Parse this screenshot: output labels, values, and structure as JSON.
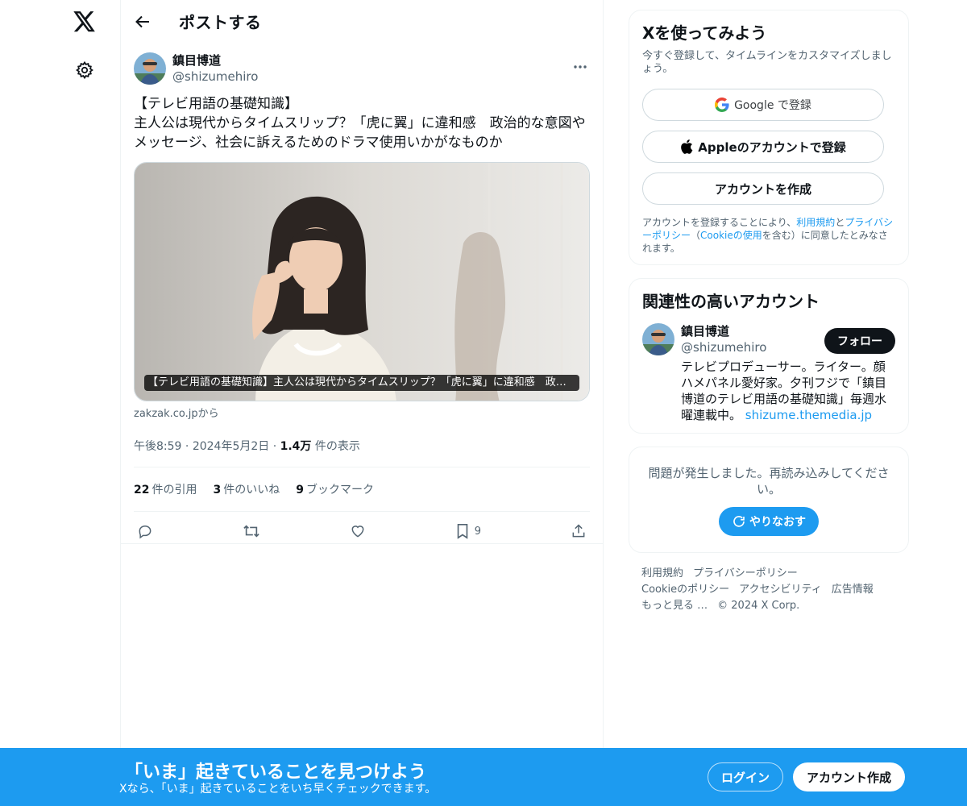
{
  "header": {
    "title": "ポストする"
  },
  "tweet": {
    "author_name": "鎮目博道",
    "author_handle": "@shizumehiro",
    "text": "【テレビ用語の基礎知識】\n主人公は現代からタイムスリップ？「虎に翼」に違和感　政治的な意図やメッセージ、社会に訴えるためのドラマ使用いかがなものか",
    "card_caption": "【テレビ用語の基礎知識】主人公は現代からタイムスリップ？「虎に翼」に違和感　政治的な意図やメッセージ、社会に訴えるためのドラマ使用いかがなものか",
    "card_source": "zakzak.co.jpから",
    "time": "午後8:59",
    "date": "2024年5月2日",
    "views_count": "1.4万",
    "views_label": " 件の表示",
    "quotes_count": "22",
    "quotes_label": "件の引用",
    "likes_count": "3",
    "likes_label": "件のいいね",
    "bookmarks_count": "9",
    "bookmarks_label": "ブックマーク",
    "bookmark_action_count": "9"
  },
  "signup": {
    "title": "Xを使ってみよう",
    "subtitle": "今すぐ登録して、タイムラインをカスタマイズしましょう。",
    "google_label": "Google で登録",
    "apple_label": "Appleのアカウントで登録",
    "create_label": "アカウントを作成",
    "legal_1": "アカウントを登録することにより、",
    "legal_terms": "利用規約",
    "legal_2": "と",
    "legal_privacy": "プライバシーポリシー",
    "legal_3": "（",
    "legal_cookie": "Cookieの使用",
    "legal_4": "を含む）に同意したとみなされます。"
  },
  "related": {
    "title": "関連性の高いアカウント",
    "name": "鎮目博道",
    "handle": "@shizumehiro",
    "follow_label": "フォロー",
    "bio": "テレビプロデューサー。ライター。顔ハメパネル愛好家。夕刊フジで「鎮目博道のテレビ用語の基礎知識」毎週水曜連載中。",
    "bio_link": "shizume.themedia.jp"
  },
  "error": {
    "message": "問題が発生しました。再読み込みしてください。",
    "retry_label": "やりなおす"
  },
  "footer": {
    "terms": "利用規約",
    "privacy": "プライバシーポリシー",
    "cookie": "Cookieのポリシー",
    "accessibility": "アクセシビリティ",
    "ads": "広告情報",
    "more": "もっと見る …",
    "copyright": "© 2024 X Corp."
  },
  "banner": {
    "title": "「いま」起きていることを見つけよう",
    "subtitle": "Xなら、「いま」起きていることをいち早くチェックできます。",
    "login_label": "ログイン",
    "create_label": "アカウント作成"
  },
  "colors": {
    "accent": "#1d9bf0",
    "text": "#0f1419",
    "muted": "#536471"
  },
  "icons": [
    "x-logo-icon",
    "gear-icon",
    "back-arrow-icon",
    "more-icon",
    "reply-icon",
    "repost-icon",
    "like-icon",
    "bookmark-icon",
    "share-icon",
    "google-icon",
    "apple-icon",
    "refresh-icon"
  ]
}
